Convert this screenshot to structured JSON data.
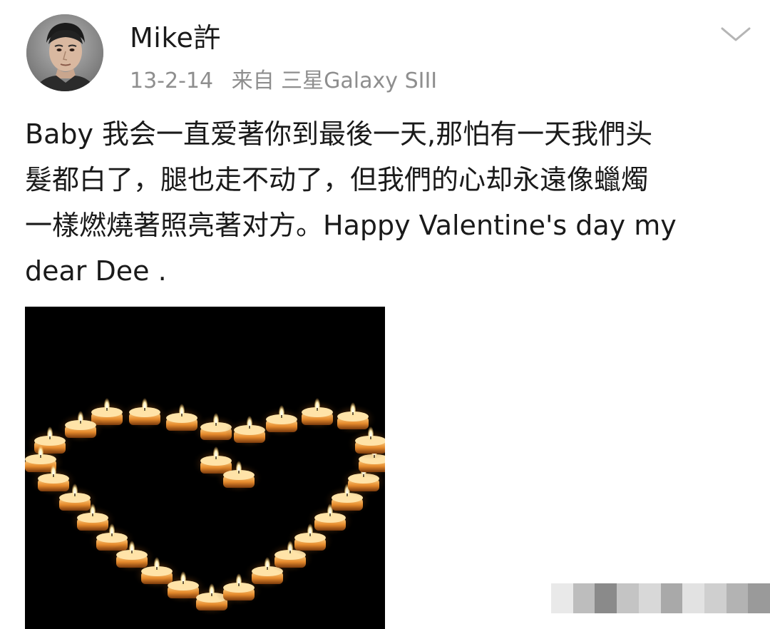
{
  "post": {
    "username": "Mike許",
    "date": "13-2-14",
    "source": "来自 三星Galaxy SIII",
    "text_lines": [
      "Baby  我会一直爱著你到最後一天,那怕有一天我們头",
      "髮都白了，腿也走不动了，但我們的心却永遠像蠟燭",
      "一樣燃燒著照亮著对方。Happy  Valentine's day my",
      "dear Dee ."
    ],
    "more_icon": "chevron-down-icon",
    "image_subject": "candle-heart"
  },
  "colors": {
    "text": "#1a1a1a",
    "meta": "#8e8e8e",
    "chevron": "#b5b5b5",
    "candle_glow": "#ffb347"
  }
}
